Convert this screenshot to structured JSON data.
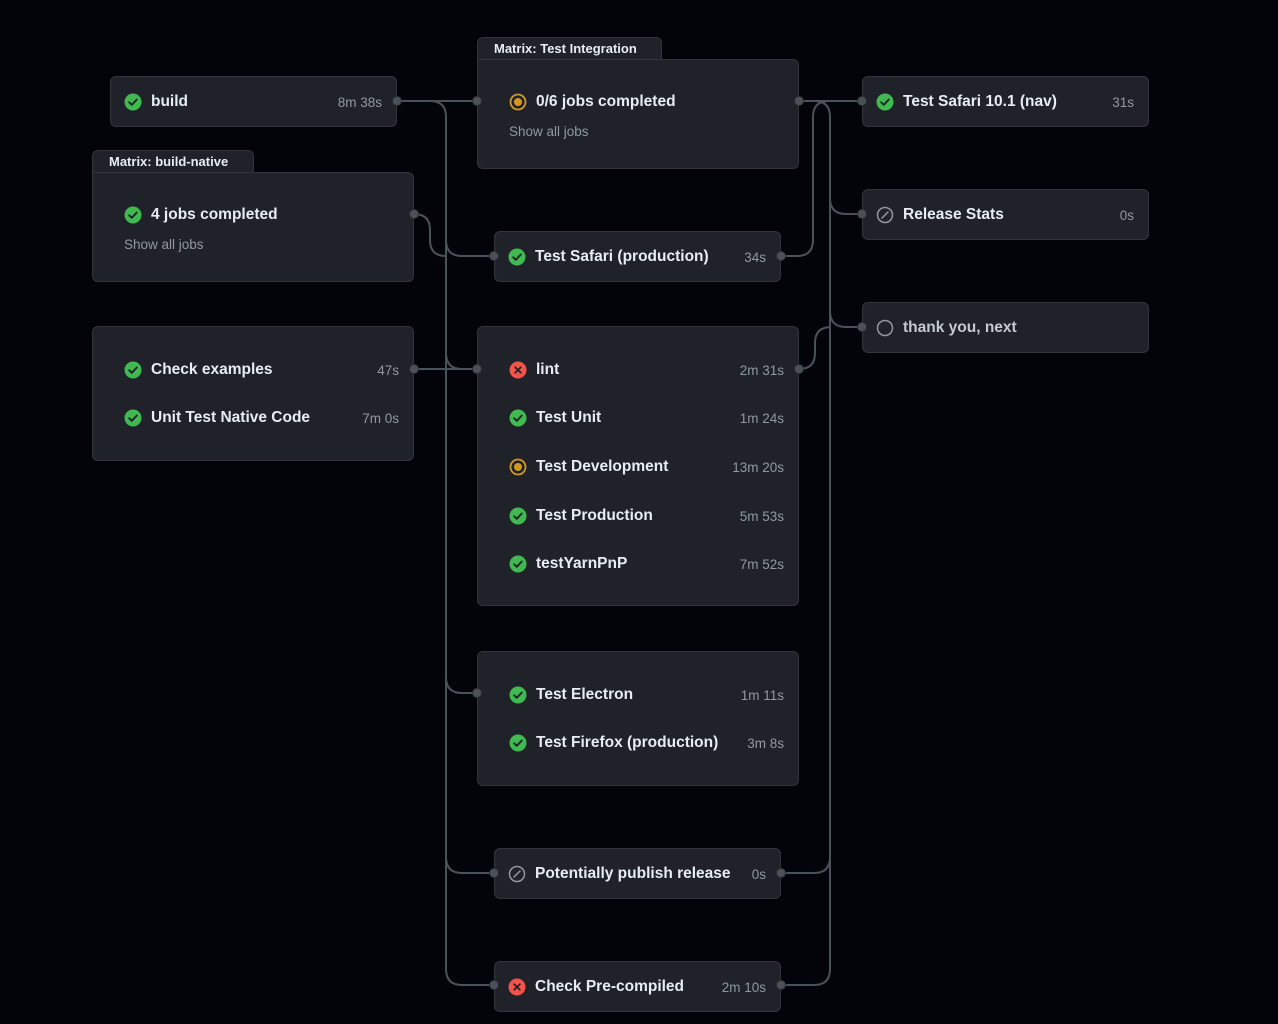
{
  "matrix_integration": {
    "label": "Matrix: Test Integration",
    "summary": "0/6 jobs completed",
    "summary_status": "in-progress",
    "link": "Show all jobs"
  },
  "matrix_native": {
    "label": "Matrix: build-native",
    "summary": "4 jobs completed",
    "summary_status": "success",
    "link": "Show all jobs"
  },
  "jobs": {
    "build": {
      "name": "build",
      "duration": "8m 38s",
      "status": "success"
    },
    "check_examples": {
      "name": "Check examples",
      "duration": "47s",
      "status": "success"
    },
    "unit_native": {
      "name": "Unit Test Native Code",
      "duration": "7m 0s",
      "status": "success"
    },
    "safari_prod": {
      "name": "Test Safari (production)",
      "duration": "34s",
      "status": "success"
    },
    "lint": {
      "name": "lint",
      "duration": "2m 31s",
      "status": "failure"
    },
    "test_unit": {
      "name": "Test Unit",
      "duration": "1m 24s",
      "status": "success"
    },
    "test_dev": {
      "name": "Test Development",
      "duration": "13m 20s",
      "status": "in-progress"
    },
    "test_prod": {
      "name": "Test Production",
      "duration": "5m 53s",
      "status": "success"
    },
    "yarn_pnp": {
      "name": "testYarnPnP",
      "duration": "7m 52s",
      "status": "success"
    },
    "electron": {
      "name": "Test Electron",
      "duration": "1m 11s",
      "status": "success"
    },
    "firefox_prod": {
      "name": "Test Firefox (production)",
      "duration": "3m 8s",
      "status": "success"
    },
    "publish": {
      "name": "Potentially publish release",
      "duration": "0s",
      "status": "skipped"
    },
    "precompiled": {
      "name": "Check Pre-compiled",
      "duration": "2m 10s",
      "status": "failure"
    },
    "safari_nav": {
      "name": "Test Safari 10.1 (nav)",
      "duration": "31s",
      "status": "success"
    },
    "release_stats": {
      "name": "Release Stats",
      "duration": "0s",
      "status": "skipped"
    },
    "thank_you": {
      "name": "thank you, next",
      "duration": "",
      "status": "pending"
    }
  },
  "colors": {
    "success": "#3fb950",
    "failure": "#f85149",
    "in_progress": "#d29922",
    "neutral": "#9198a1",
    "background": "#020409",
    "card": "#1f2329"
  }
}
